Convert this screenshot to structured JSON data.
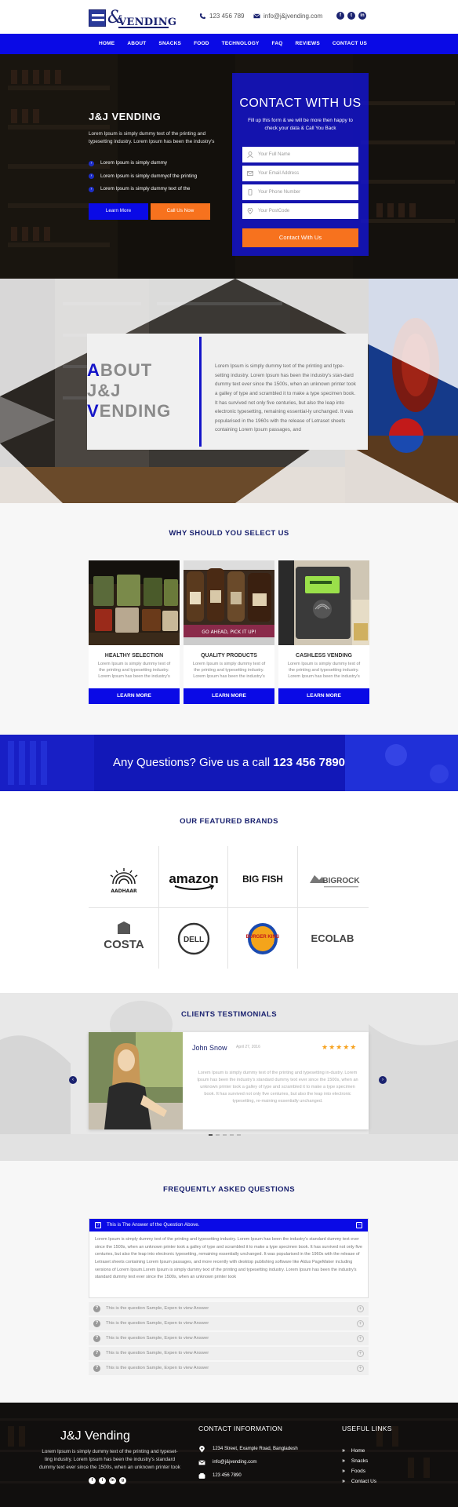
{
  "header": {
    "logo_text": "VENDING",
    "logo_amp": "&",
    "phone": "123 456 789",
    "email": "info@j&jvending.com",
    "social": [
      "f",
      "t",
      "in"
    ]
  },
  "nav": {
    "items": [
      "HOME",
      "ABOUT",
      "SNACKS",
      "FOOD",
      "TECHNOLOGY",
      "FAQ",
      "REVIEWS",
      "CONTACT US"
    ]
  },
  "hero": {
    "title": "J&J VENDING",
    "description": "Lorem Ipsum is simply dummy text of the printing and typesetting industry. Lorem Ipsum has been the industry's",
    "bullets": [
      "Lorem Ipsum is simply dummy",
      "Lorem Ipsum is simply dummyof the printing",
      "Lorem Ipsum is simply dummy text of the"
    ],
    "learn_more": "Learn More",
    "call_us": "Call Us Now"
  },
  "contact_form": {
    "title": "CONTACT WITH US",
    "subtitle": "Fill up this form & we will be more then happy to check your data & Call You Back",
    "fields": {
      "name": "Your Full Name",
      "email": "Your Email Address",
      "phone": "Your Phone Number",
      "postcode": "Your PostCode"
    },
    "submit": "Contact With Us"
  },
  "about": {
    "title_line1_first": "A",
    "title_line1_rest": "BOUT",
    "title_line2": "J&J",
    "title_line3_first": "V",
    "title_line3_rest": "ENDING",
    "text": "Lorem Ipsum is simply dummy text of the printing and type-setting industry. Lorem Ipsum has been the industry's stan-dard dummy text ever since the 1500s, when an unknown printer took a galley of type and scrambled it to make a type specimen book. It has survived not only five centuries, but also the leap into electronic typesetting, remaining essential-ly unchanged. It was popularised in the 1960s with the release of Letraset sheets containing Lorem Ipsum passages, and"
  },
  "why": {
    "title": "WHY SHOULD YOU SELECT US",
    "cards": [
      {
        "title": "HEALTHY SELECTION",
        "text": "Lorem Ipsum is simply dummy text of the printing and typesetting industry. Lorem Ipsum has been the industry's",
        "button": "LEARN MORE"
      },
      {
        "title": "QUALITY PRODUCTS",
        "text": "Lorem Ipsum is simply dummy text of the printing and typesetting industry. Lorem Ipsum has been the industry's",
        "button": "LEARN MORE",
        "sign": "GO AHEAD, PICK IT UP!"
      },
      {
        "title": "CASHLESS VENDING",
        "text": "Lorem Ipsum is simply dummy text of the printing and typesetting industry. Lorem Ipsum has been the industry's",
        "button": "LEARN MORE"
      }
    ]
  },
  "call_band": {
    "text": "Any Questions? Give us a call",
    "number": "123 456 7890"
  },
  "brands": {
    "title": "OUR FEATURED BRANDS",
    "items": [
      "AADHAAR",
      "amazon",
      "BIG FISH",
      "BIGROCK",
      "COSTA",
      "DELL",
      "BURGER KING",
      "ECOLAB"
    ]
  },
  "testimonials": {
    "title": "CLIENTS TESTIMONIALS",
    "name": "John Snow",
    "date": "April 27, 2016",
    "stars": "★★★★★",
    "text": "Lorem Ipsum is simply dummy text of the printing and typesetting in-dustry. Lorem Ipsum has been the industry's standard dummy text ever since the 1500s, when an unknown printer took a galley of type and scrambled it to make a type specimen book. It has survived not only five centuries, but also the leap into electronic typesetting, re-maining essentially unchanged."
  },
  "faq": {
    "title": "FREQUENTLY ASKED QUESTIONS",
    "open_question": "This is The Answer of the Question Above.",
    "open_answer": "Lorem Ipsum is simply dummy text of the printing and typesetting industry. Lorem Ipsum has been the industry's standard dummy text ever since the 1500s, when an unknown printer took a galley of type and scrambled it to make a type specimen book. It has survived not only five centuries, but also the leap into electronic typesetting, remaining essentially unchanged. It was popularised in the 1960s with the release of Letraset sheets containing Lorem Ipsum passages, and more recently with desktop publishing software like Aldus PageMaker including versions of Lorem Ipsum.Lorem Ipsum is simply dummy text of the printing and typesetting industry. Lorem Ipsum has been the industry's standard dummy text ever since the 1500s, when an unknown printer took",
    "questions": [
      "This is the question Sample, Expen to view Answer",
      "This is the question Sample, Expen to view Answer",
      "This is the question Sample, Expen to view Answer",
      "This is the question Sample, Expen to view Answer",
      "This is the question Sample, Expen to view Answer"
    ]
  },
  "footer": {
    "title": "J&J Vending",
    "description": "Lorem Ipsum is simply dummy text of the printing and typeset-ting industry. Lorem Ipsum has been the industry's standard dummy text ever since the 1500s, when an unknown printer took",
    "social": [
      "f",
      "t",
      "in",
      "g"
    ],
    "contact_heading": "CONTACT INFORMATION",
    "address": "1234 Street, Example Road, Bangladesh",
    "email": "info@j&jvending.com",
    "phone": "123 456 7890",
    "links_heading": "USEFUL LINKS",
    "links": [
      "Home",
      "Snacks",
      "Foods",
      "Contact Us"
    ]
  },
  "colors": {
    "primary_blue": "#0a0ae6",
    "navy": "#1b2370",
    "orange": "#f7721e",
    "star": "#f7a21e"
  }
}
